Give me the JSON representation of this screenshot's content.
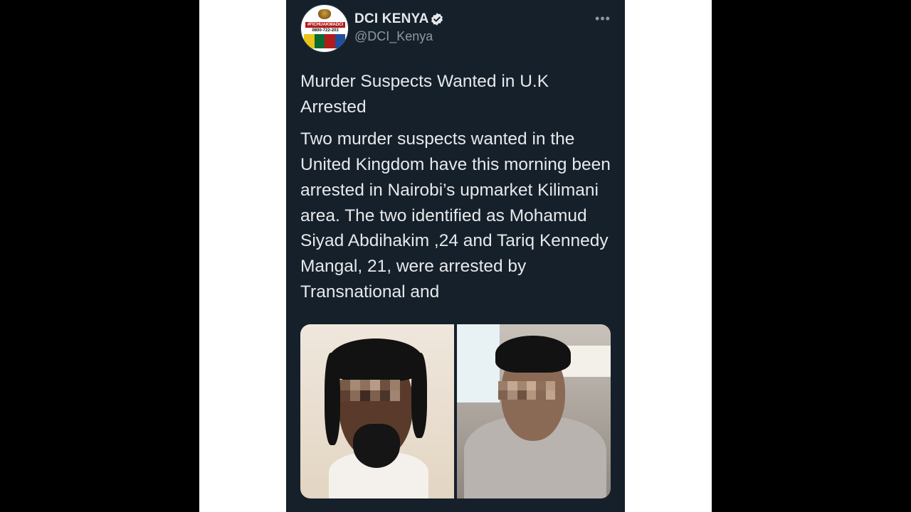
{
  "tweet": {
    "author": {
      "display_name": "DCI KENYA",
      "handle": "@DCI_Kenya",
      "verified": true,
      "avatar": {
        "hashtag": "#FICHUAKWADCI",
        "phone": "0800-722-203",
        "stripe_colors": [
          "#e8c419",
          "#0b6a2f",
          "#b31b1b",
          "#1d4f9c"
        ]
      }
    },
    "more_icon": "ellipsis-icon",
    "headline": "Murder Suspects Wanted in U.K Arrested",
    "body": "Two murder suspects wanted in the United Kingdom have this morning been arrested in Nairobi’s upmarket Kilimani area. The two identified as Mohamud Siyad Abdihakim ,24 and Tariq Kennedy Mangal, 21, were arrested by Transnational and",
    "media": {
      "count": 2,
      "photos": [
        "suspect-photo-1",
        "suspect-photo-2"
      ]
    }
  },
  "colors": {
    "page_bg": "#000000",
    "panel_bg": "#ffffff",
    "tweet_bg": "#15202b",
    "text_primary": "#e7e9ea",
    "text_secondary": "#8b98a5",
    "verified_blue": "#e7e9ea"
  }
}
